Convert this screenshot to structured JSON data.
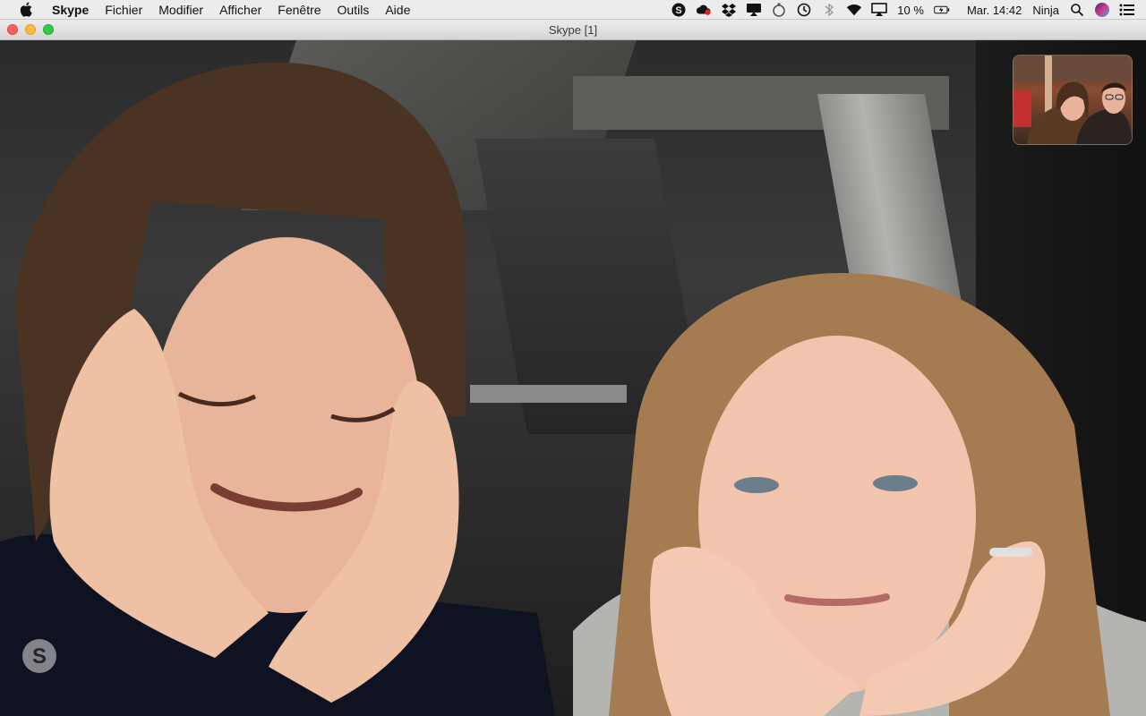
{
  "menubar": {
    "app_name": "Skype",
    "menus": [
      "Fichier",
      "Modifier",
      "Afficher",
      "Fenêtre",
      "Outils",
      "Aide"
    ],
    "battery": "10 %",
    "clock": "Mar. 14:42",
    "user": "Ninja",
    "tray_icons": [
      "skype-icon",
      "creative-cloud-icon",
      "dropbox-icon",
      "airplay-display-icon",
      "timer-icon",
      "time-machine-icon",
      "bluetooth-icon",
      "wifi-icon",
      "airplay-icon",
      "battery-icon",
      "spotlight-icon",
      "siri-icon",
      "notification-center-icon"
    ]
  },
  "window": {
    "title": "Skype [1]"
  },
  "call": {
    "remote_participants_visible": 2,
    "self_view": "self-view-thumbnail",
    "badge_icon": "skype-logo-icon"
  }
}
